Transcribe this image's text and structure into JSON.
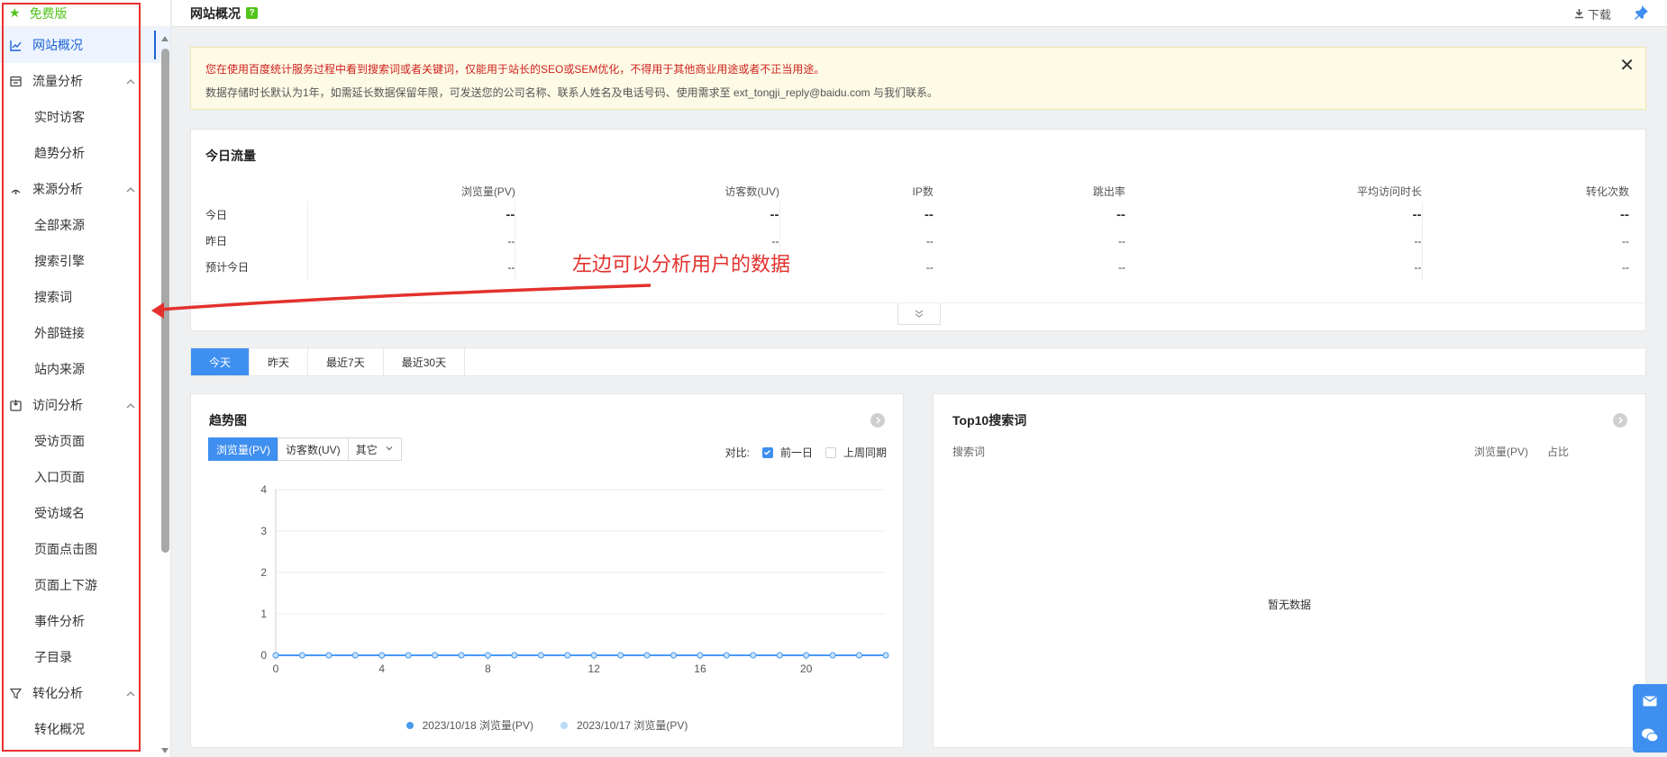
{
  "sidebar": {
    "edition": "免费版",
    "items": [
      {
        "type": "group",
        "label": "网站概况",
        "icon": "line-chart-icon",
        "active": true
      },
      {
        "type": "group",
        "label": "流量分析",
        "icon": "traffic-icon",
        "expandable": true
      },
      {
        "type": "sub",
        "label": "实时访客"
      },
      {
        "type": "sub",
        "label": "趋势分析"
      },
      {
        "type": "group",
        "label": "来源分析",
        "icon": "signal-icon",
        "expandable": true
      },
      {
        "type": "sub",
        "label": "全部来源"
      },
      {
        "type": "sub",
        "label": "搜索引擎"
      },
      {
        "type": "sub",
        "label": "搜索词"
      },
      {
        "type": "sub",
        "label": "外部链接"
      },
      {
        "type": "sub",
        "label": "站内来源"
      },
      {
        "type": "group",
        "label": "访问分析",
        "icon": "visit-icon",
        "expandable": true
      },
      {
        "type": "sub",
        "label": "受访页面"
      },
      {
        "type": "sub",
        "label": "入口页面"
      },
      {
        "type": "sub",
        "label": "受访域名"
      },
      {
        "type": "sub",
        "label": "页面点击图"
      },
      {
        "type": "sub",
        "label": "页面上下游"
      },
      {
        "type": "sub",
        "label": "事件分析"
      },
      {
        "type": "sub",
        "label": "子目录"
      },
      {
        "type": "group",
        "label": "转化分析",
        "icon": "funnel-icon",
        "expandable": true
      },
      {
        "type": "sub",
        "label": "转化概况"
      }
    ]
  },
  "header": {
    "title": "网站概况",
    "help": "?",
    "download": "下载"
  },
  "notice": {
    "line1": "您在使用百度统计服务过程中看到搜索词或者关键词，仅能用于站长的SEO或SEM优化，不得用于其他商业用途或者不正当用途。",
    "line2": "数据存储时长默认为1年，如需延长数据保留年限，可发送您的公司名称、联系人姓名及电话号码、使用需求至 ext_tongji_reply@baidu.com 与我们联系。",
    "close": "✕"
  },
  "today": {
    "title": "今日流量",
    "columns": [
      "",
      "浏览量(PV)",
      "访客数(UV)",
      "IP数",
      "跳出率",
      "平均访问时长",
      "转化次数"
    ],
    "rows": [
      {
        "label": "今日",
        "values": [
          "--",
          "--",
          "--",
          "--",
          "--",
          "--"
        ],
        "bold": true
      },
      {
        "label": "昨日",
        "values": [
          "--",
          "--",
          "--",
          "--",
          "--",
          "--"
        ],
        "bold": false
      },
      {
        "label": "预计今日",
        "values": [
          "--",
          "--",
          "--",
          "--",
          "--",
          "--"
        ],
        "bold": false
      }
    ]
  },
  "annotation": "左边可以分析用户的数据",
  "date_tabs": [
    "今天",
    "昨天",
    "最近7天",
    "最近30天"
  ],
  "trend": {
    "title": "趋势图",
    "metrics": [
      "浏览量(PV)",
      "访客数(UV)",
      "其它"
    ],
    "compare_label": "对比:",
    "compare_options": [
      {
        "label": "前一日",
        "checked": true
      },
      {
        "label": "上周同期",
        "checked": false
      }
    ]
  },
  "chart_data": {
    "type": "line",
    "x": [
      0,
      1,
      2,
      3,
      4,
      5,
      6,
      7,
      8,
      9,
      10,
      11,
      12,
      13,
      14,
      15,
      16,
      17,
      18,
      19,
      20,
      21,
      22,
      23
    ],
    "xticks": [
      0,
      4,
      8,
      12,
      16,
      20
    ],
    "ylim": [
      0,
      4
    ],
    "yticks": [
      0,
      1,
      2,
      3,
      4
    ],
    "grid": true,
    "series": [
      {
        "name": "2023/10/18 浏览量(PV)",
        "color": "#4a9af0",
        "values": [
          0,
          0,
          0,
          0,
          0,
          0,
          0,
          0,
          0,
          0,
          0,
          0,
          0,
          0,
          0,
          0,
          0,
          0,
          0,
          0,
          0,
          0,
          0,
          0
        ]
      },
      {
        "name": "2023/10/17 浏览量(PV)",
        "color": "#b9dbf8",
        "values": [
          0,
          0,
          0,
          0,
          0,
          0,
          0,
          0,
          0,
          0,
          0,
          0,
          0,
          0,
          0,
          0,
          0,
          0,
          0,
          0,
          0,
          0,
          0,
          0
        ]
      }
    ]
  },
  "top10": {
    "title": "Top10搜索词",
    "col_keyword": "搜索词",
    "col_pv": "浏览量(PV)",
    "col_ratio": "占比",
    "empty": "暂无数据"
  },
  "colors": {
    "accent": "#3f8ff0",
    "annotation_red": "#e3312d",
    "free_green": "#52c41a"
  }
}
